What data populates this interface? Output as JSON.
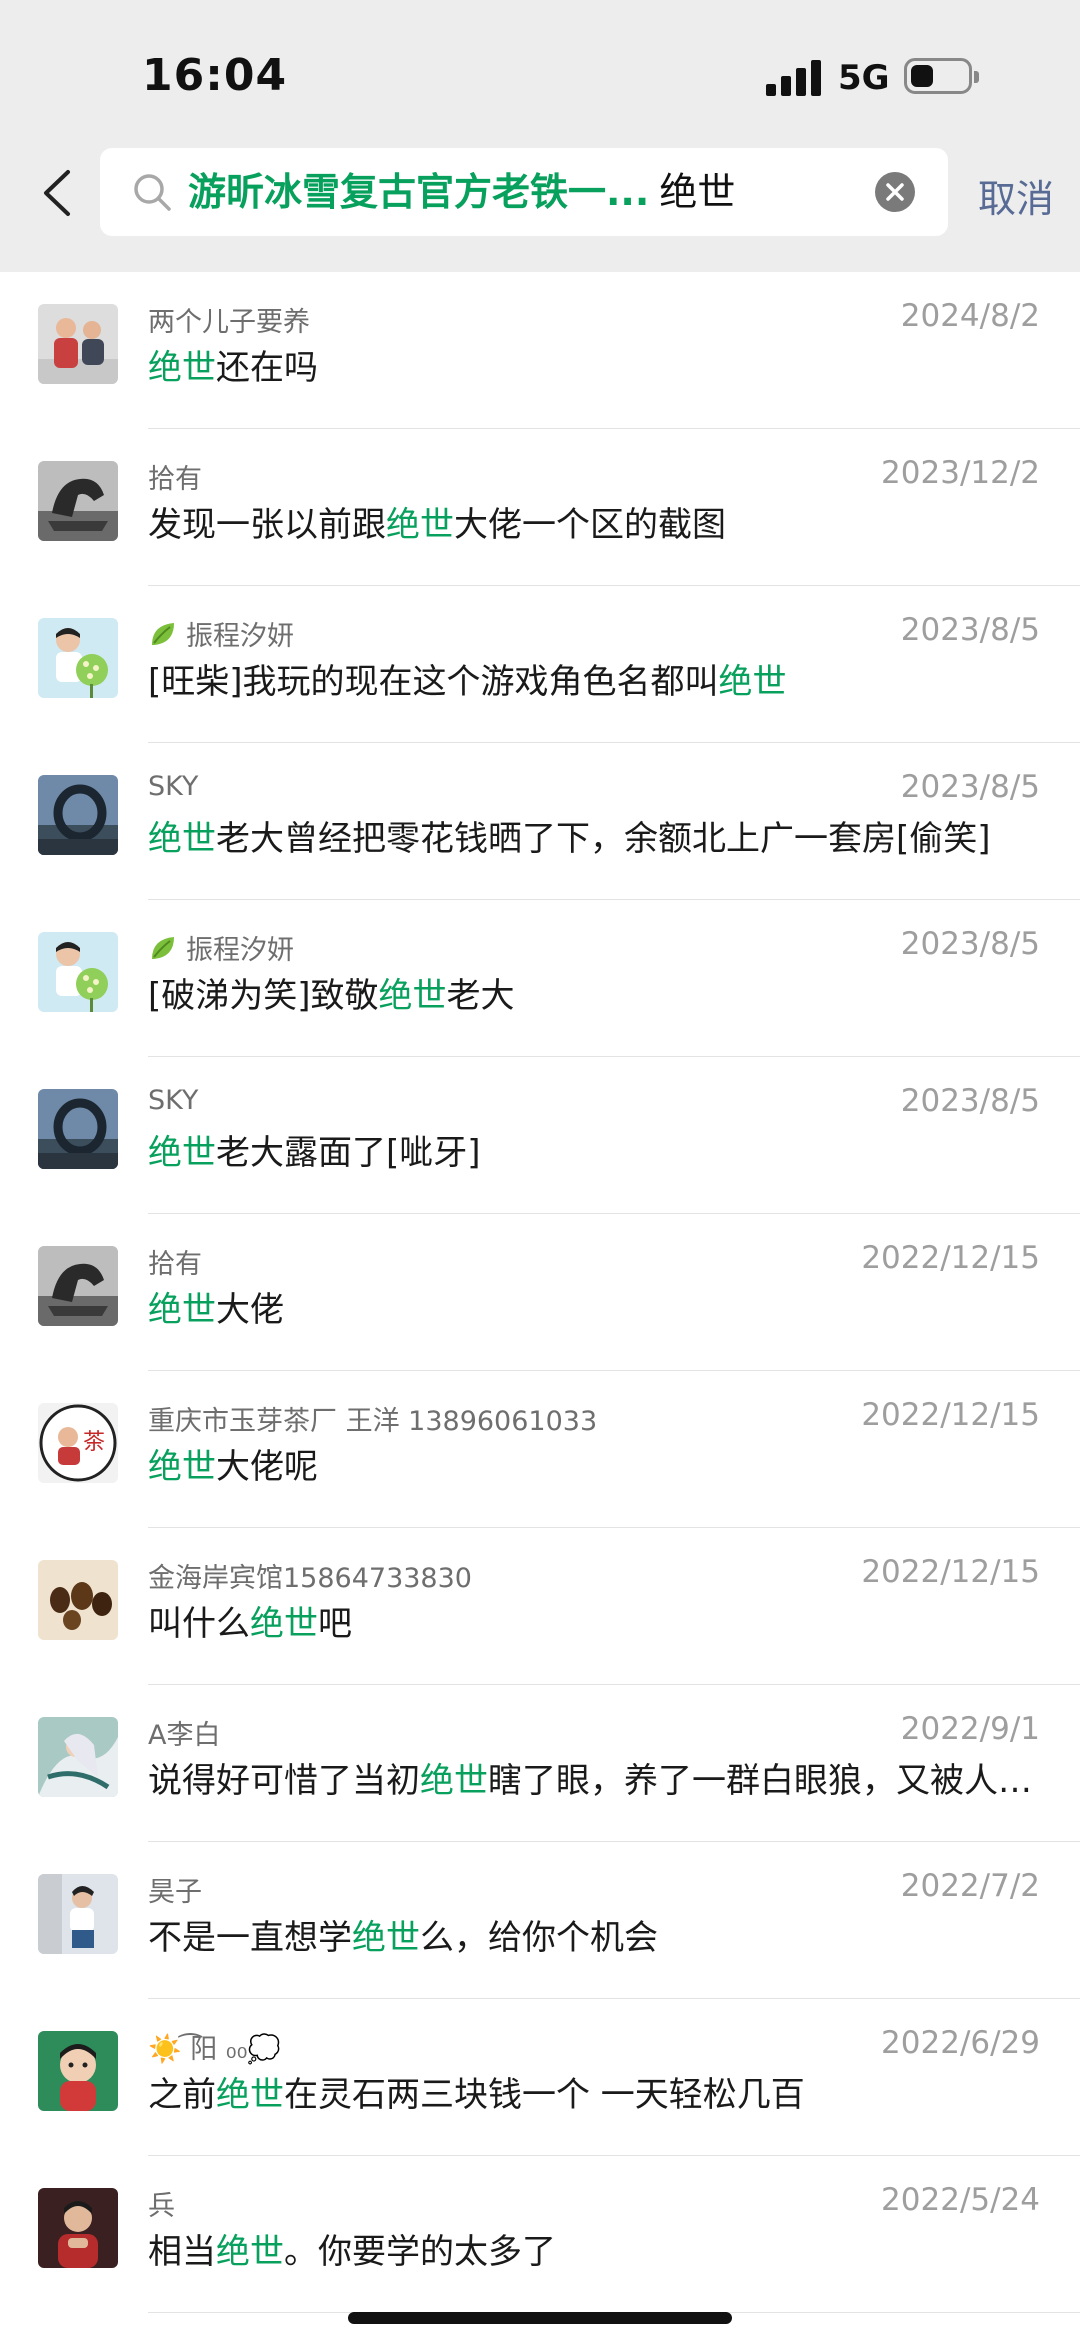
{
  "status_bar": {
    "time": "16:04",
    "network": "5G"
  },
  "search": {
    "scope": "游昕冰雪复古官方老铁一...",
    "keyword": "绝世",
    "cancel_label": "取消"
  },
  "results": [
    {
      "sender": "两个儿子要养",
      "date": "2024/8/2",
      "pre": "",
      "hl": "绝世",
      "post": "还在吗",
      "avatar": "kids"
    },
    {
      "sender": "拾有",
      "date": "2023/12/2",
      "pre": "发现一张以前跟",
      "hl": "绝世",
      "post": "大佬一个区的截图",
      "avatar": "statue"
    },
    {
      "sender": "振程汐妍",
      "date": "2023/8/5",
      "pre": "[旺柴]我玩的现在这个游戏角色名都叫",
      "hl": "绝世",
      "post": "",
      "avatar": "flowers",
      "leaf": true
    },
    {
      "sender": "SKY",
      "date": "2023/8/5",
      "pre": "",
      "hl": "绝世",
      "post": "老大曾经把零花钱晒了下，余额北上广一套房[偷笑]",
      "avatar": "sky"
    },
    {
      "sender": "振程汐妍",
      "date": "2023/8/5",
      "pre": "[破涕为笑]致敬",
      "hl": "绝世",
      "post": "老大",
      "avatar": "flowers",
      "leaf": true
    },
    {
      "sender": "SKY",
      "date": "2023/8/5",
      "pre": "",
      "hl": "绝世",
      "post": "老大露面了[呲牙]",
      "avatar": "sky"
    },
    {
      "sender": "拾有",
      "date": "2022/12/15",
      "pre": "",
      "hl": "绝世",
      "post": "大佬",
      "avatar": "statue"
    },
    {
      "sender": "重庆市玉芽茶厂 王洋 13896061033",
      "date": "2022/12/15",
      "pre": "",
      "hl": "绝世",
      "post": "大佬呢",
      "avatar": "tea"
    },
    {
      "sender": "金海岸宾馆15864733830",
      "date": "2022/12/15",
      "pre": "叫什么",
      "hl": "绝世",
      "post": "吧",
      "avatar": "hotel"
    },
    {
      "sender": "A李白",
      "date": "2022/9/1",
      "pre": "说得好可惜了当初",
      "hl": "绝世",
      "post": "瞎了眼，养了一群白眼狼，又被人骗了",
      "avatar": "libai"
    },
    {
      "sender": "昊子",
      "date": "2022/7/2",
      "pre": "不是一直想学",
      "hl": "绝世",
      "post": "么，给你个机会",
      "avatar": "haozi"
    },
    {
      "sender": "☀️ ͡阳 ₀₀💭",
      "date": "2022/6/29",
      "pre": "之前",
      "hl": "绝世",
      "post": "在灵石两三块钱一个  一天轻松几百",
      "avatar": "baby"
    },
    {
      "sender": "兵",
      "date": "2022/5/24",
      "pre": "相当",
      "hl": "绝世",
      "post": "。你要学的太多了",
      "avatar": "bing"
    }
  ],
  "colors": {
    "highlight": "#07a05c",
    "cancel": "#576b95",
    "header_bg": "#ededed"
  }
}
